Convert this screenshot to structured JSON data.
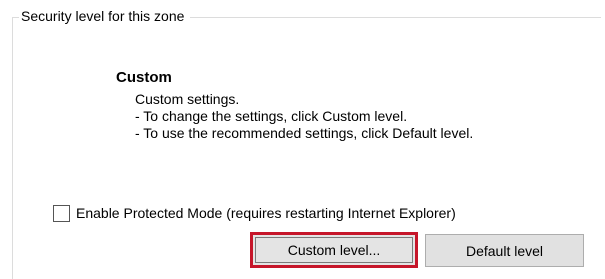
{
  "group": {
    "legend": "Security level for this zone"
  },
  "level": {
    "title": "Custom",
    "lines": [
      "Custom settings.",
      "- To change the settings, click Custom level.",
      "- To use the recommended settings, click Default level."
    ]
  },
  "protected_mode": {
    "label": "Enable Protected Mode (requires restarting Internet Explorer)",
    "checked": false
  },
  "buttons": {
    "custom_level": "Custom level...",
    "default_level": "Default level"
  },
  "colors": {
    "highlight_border": "#c6162a",
    "button_face": "#e1e1e1"
  }
}
